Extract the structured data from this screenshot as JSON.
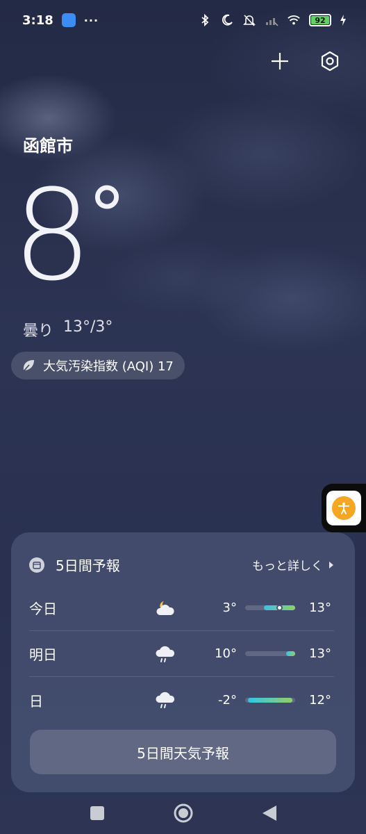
{
  "status_bar": {
    "time": "3:18",
    "dots": "···",
    "battery": "92"
  },
  "city": "函館市",
  "current": {
    "temperature": "8",
    "degree": "°",
    "condition": "曇り",
    "range": "13°/3°"
  },
  "aqi": {
    "label": "大気汚染指数 (AQI) 17"
  },
  "forecast": {
    "title": "5日間予報",
    "more_label": "もっと詳しく",
    "button_label": "5日間天気予報",
    "days": [
      {
        "day": "今日",
        "icon": "partly-cloudy-night-icon",
        "low": "3°",
        "high": "13°",
        "bar_start": 0.38,
        "bar_end": 1.0,
        "current_fraction": 0.68
      },
      {
        "day": "明日",
        "icon": "rain-icon",
        "low": "10°",
        "high": "13°",
        "bar_start": 0.82,
        "bar_end": 1.0
      },
      {
        "day": "日",
        "icon": "rain-icon",
        "low": "-2°",
        "high": "12°",
        "bar_start": 0.05,
        "bar_end": 0.95
      }
    ]
  },
  "colors": {
    "bar_cool": "#37c3e6",
    "bar_warm": "#8fd06b",
    "accessibility": "#f5a623",
    "battery": "#5fd35f"
  }
}
